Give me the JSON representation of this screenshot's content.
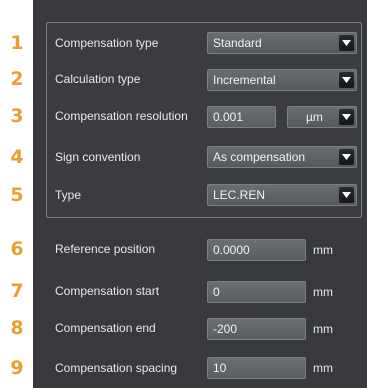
{
  "rows": [
    {
      "number": "1",
      "label": "Compensation type",
      "value": "Standard"
    },
    {
      "number": "2",
      "label": "Calculation type",
      "value": "Incremental"
    },
    {
      "number": "3",
      "label": "Compensation resolution",
      "value": "0.001",
      "unit": "µm"
    },
    {
      "number": "4",
      "label": "Sign convention",
      "value": "As compensation"
    },
    {
      "number": "5",
      "label": "Type",
      "value": "LEC.REN"
    },
    {
      "number": "6",
      "label": "Reference position",
      "value": "0.0000",
      "unit": "mm"
    },
    {
      "number": "7",
      "label": "Compensation start",
      "value": "0",
      "unit": "mm"
    },
    {
      "number": "8",
      "label": "Compensation end",
      "value": "-200",
      "unit": "mm"
    },
    {
      "number": "9",
      "label": "Compensation spacing",
      "value": "10",
      "unit": "mm"
    }
  ],
  "colors": {
    "number_accent": "#e8a030",
    "panel_background": "#37393c",
    "field_background": "#5f6267",
    "dropdown_button": "#1c1d20",
    "text": "#e8e9ea"
  },
  "icons": {
    "dropdown": "chevron-down-icon"
  }
}
